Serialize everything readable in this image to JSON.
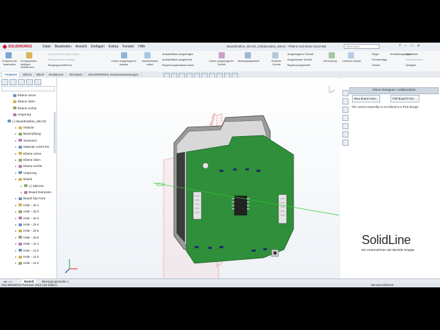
{
  "app": {
    "brand": "SOLIDWORKS",
    "menu": [
      "Datei",
      "Bearbeiten",
      "Ansicht",
      "Einfügen",
      "Extras",
      "Fenster",
      "Hilfe"
    ],
    "doc_title": "BoardOutline_MCAD_Collaboration_Demo - Platine und Motor.SLDASM",
    "search_placeholder": "Hilfe/Suche"
  },
  "ribbon": {
    "komponenten": "Komponente bearbeiten",
    "komponenten_einfuegen": "Komponenten einfügen",
    "referenz": "Referenzen",
    "line1": "Komponenten wiederholen",
    "line2": "Komponenten anzeigen",
    "line3": "Baugruppenreferenz",
    "linear": "Linear ausgetragener Aufsatz",
    "aufsatz": "Aufsatz/Basis rotiert",
    "aufsatz_ausgetragen": "Aufsatz/Basis ausgetragen",
    "aufsatz_ausgeformt": "Aufsatz/Basis ausgeformt",
    "begrenzung": "Begrenzungsaufsatz/-basis",
    "schnitt": "Linear ausgetragener Schnitt",
    "bohrung": "Bohrungsassistent",
    "rotierter_schnitt": "Rotierter Schnitt",
    "ausgetragener_schnitt": "Ausgetragener Schnitt",
    "ausgeformter_schnitt": "Ausgeformter Schnitt",
    "begrenzungsschnitt": "Begrenzungsschnitt",
    "verrundung": "Verrundung",
    "lineares_muster": "Lineares Muster",
    "rippe": "Rippe",
    "formschraege": "Formschräge",
    "schale": "Schale",
    "verstaerkung": "Verstärkungsrippe",
    "umwickeln": "Umwickeln",
    "ueberschneiden": "Überschneiden",
    "spiegeln": "Spiegeln"
  },
  "tabs": [
    "Features",
    "Skizze",
    "Blech",
    "Evaluieren",
    "DimXpert",
    "SOLIDWORKS Zusatzanwendungen"
  ],
  "tree": [
    {
      "label": "Ebene vorne",
      "level": 1
    },
    {
      "label": "Ebene oben",
      "level": 1
    },
    {
      "label": "Ebene rechts",
      "level": 1
    },
    {
      "label": "Ursprung",
      "level": 1
    },
    {
      "label": "(-) BoardOutline_MCAD",
      "level": 0
    },
    {
      "label": "Historie",
      "level": 2
    },
    {
      "label": "Beschriftung",
      "level": 2
    },
    {
      "label": "Sensoren",
      "level": 2
    },
    {
      "label": "Material <nicht fes",
      "level": 2
    },
    {
      "label": "Ebene vorne",
      "level": 2
    },
    {
      "label": "Ebene oben",
      "level": 2
    },
    {
      "label": "Ebene rechts",
      "level": 2
    },
    {
      "label": "Ursprung",
      "level": 2
    },
    {
      "label": "Board",
      "level": 2
    },
    {
      "label": "(-) Skizze1",
      "level": 3
    },
    {
      "label": "Board Extrusion",
      "level": 3
    },
    {
      "label": "Board Top Face",
      "level": 2
    },
    {
      "label": "Hole - J2-1",
      "level": 2
    },
    {
      "label": "Hole - J2-2",
      "level": 2
    },
    {
      "label": "Hole - J2-3",
      "level": 2
    },
    {
      "label": "Hole - J2-4",
      "level": 2
    },
    {
      "label": "Hole - J2-5",
      "level": 2
    },
    {
      "label": "Hole - J2-6",
      "level": 2
    },
    {
      "label": "Hole - J1-1",
      "level": 2
    },
    {
      "label": "Hole - J1-2",
      "level": 2
    },
    {
      "label": "Hole - J1-3",
      "level": 2
    },
    {
      "label": "Hole - J1-4",
      "level": 2
    }
  ],
  "viewport": {
    "plane_label": "Rechts"
  },
  "right_panel": {
    "header": "Altium Designer Collaboration",
    "btn_new": "New Board Asse...",
    "btn_pull": "Pull Board From ...",
    "message": "The current assembly is not linked to a PCB design."
  },
  "watermark": {
    "brand_solid": "Solid",
    "brand_line": "Line",
    "tagline": "Ein Unternehmen der Bechtle Gruppe"
  },
  "bottom_tabs": [
    "Modell",
    "Bewegungsstudie 1"
  ],
  "status": {
    "left": "SOLIDWORKS Premium 2016 x64-Edition",
    "right": "Benutzerdefiniert"
  },
  "colors": {
    "pcb": "#2f8f3a",
    "brand_red": "#c8102e"
  }
}
